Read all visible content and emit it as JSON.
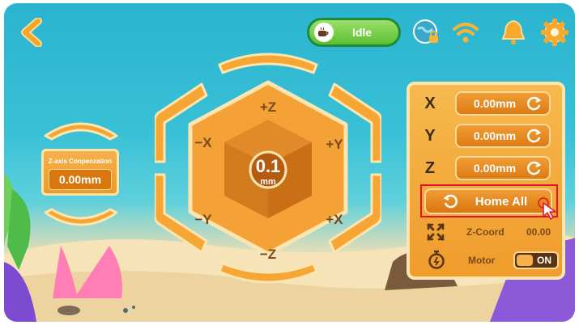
{
  "header": {
    "back_icon": "back-chevron-icon",
    "status": {
      "label": "Idle",
      "icon": "coffee-cup-icon"
    },
    "icons": [
      "network-lock-icon",
      "wifi-icon",
      "bell-icon",
      "gear-icon"
    ]
  },
  "zcomp": {
    "label": "Z-axis Conpenzation",
    "value": "0.00mm"
  },
  "jog": {
    "step": "0.1",
    "unit": "mm",
    "labels": {
      "pz": "+Z",
      "nz": "−Z",
      "nx": "−X",
      "px": "+X",
      "ny": "−Y",
      "py": "+Y"
    }
  },
  "panel": {
    "axes": [
      {
        "axis": "X",
        "value": "0.00mm"
      },
      {
        "axis": "Y",
        "value": "0.00mm"
      },
      {
        "axis": "Z",
        "value": "0.00mm"
      }
    ],
    "home_all": "Home All",
    "zcoord": {
      "label": "Z-Coord",
      "value": "00.00"
    },
    "motor": {
      "label": "Motor",
      "state": "ON"
    }
  },
  "colors": {
    "accent": "#ef9a27",
    "cream": "#fde5b2",
    "water": "#38c0d6",
    "sand": "#f3dfb3",
    "highlight": "#e0142a"
  }
}
